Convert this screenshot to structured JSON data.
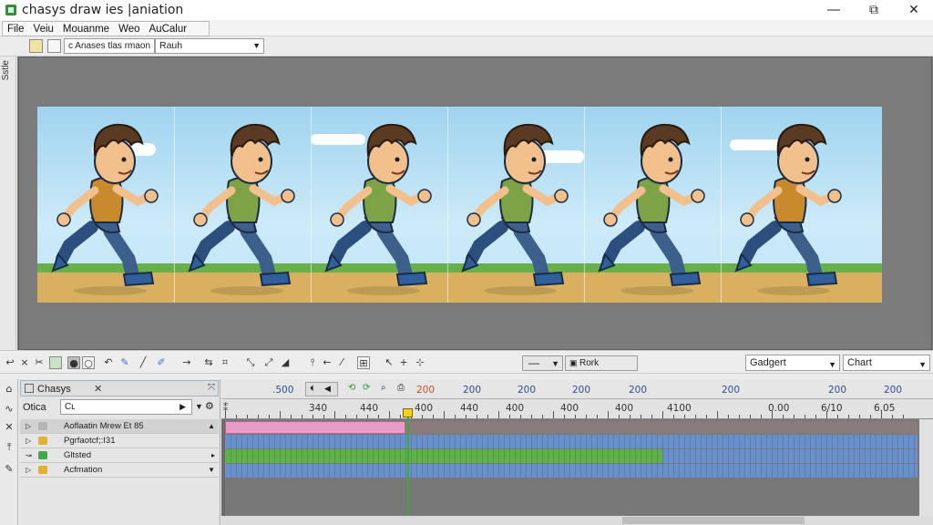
{
  "window": {
    "title": "chasys draw ies |aniation",
    "minimize": "―",
    "restore": "⧉",
    "close": "✕"
  },
  "menu": [
    "File",
    "Veiu",
    "Mouanme",
    "Weo",
    "AuCalur"
  ],
  "toolbar2": {
    "file_combo": "c Anases tlas rmaon",
    "layer_combo": "Rauh"
  },
  "left_strip": {
    "label": "Sstle"
  },
  "canvas": {
    "frames": 6,
    "shirt_colors": [
      "#c98a2e",
      "#7ea346",
      "#7ea346",
      "#7ea346",
      "#7ea346",
      "#c98a2e"
    ],
    "sky_color": "#a8d8f0",
    "grass_color": "#6ab04a",
    "dirt_color": "#d8b060"
  },
  "tool_row": {
    "frame_minus": "—",
    "frame_button": "Rork",
    "gadget_combo": "Gadgert",
    "chart_combo": "Chart"
  },
  "layers_panel": {
    "tab_label": "Chasys",
    "tab_close": "✕",
    "opacity_label": "Otica",
    "opacity_value": "Cʟ",
    "rows": [
      {
        "label": "Aoflaatin Mrew Et 85",
        "icon_color": "#b4b4b4"
      },
      {
        "label": "Pgrfaotcf;:I31",
        "icon_color": "#e0b32b"
      },
      {
        "label": "Gltsted",
        "icon_color": "#3fa64a"
      },
      {
        "label": "Acfmation",
        "icon_color": "#e0b32b"
      }
    ]
  },
  "timeline": {
    "header_ticks": [
      ".500",
      "200",
      "200",
      "200",
      "200",
      "200",
      "200",
      "200",
      "200"
    ],
    "ruler_ticks": [
      "⁑",
      "340",
      "440",
      "400",
      "440",
      "400",
      "400",
      "400",
      "4100",
      "0.00",
      "6/10",
      "6.05"
    ],
    "playhead_frame": "▼",
    "track_colors": [
      "#e89bc7",
      "#6a90c9",
      "#5fb14a",
      "#6a90c9"
    ]
  }
}
